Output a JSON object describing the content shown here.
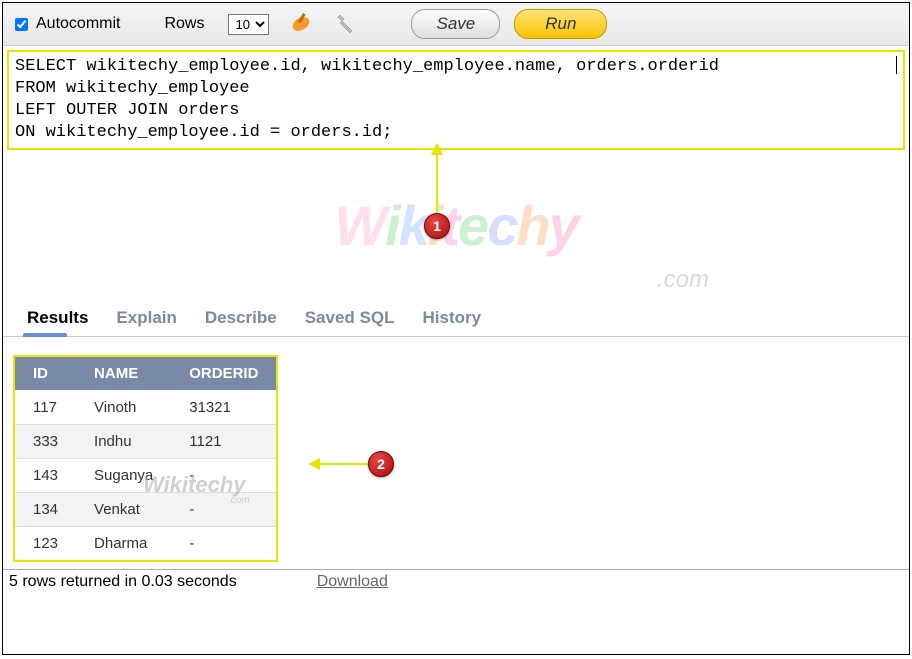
{
  "toolbar": {
    "autocommit_label": "Autocommit",
    "autocommit_checked": true,
    "rows_label": "Rows",
    "rows_value": "10",
    "save_label": "Save",
    "run_label": "Run"
  },
  "sql": {
    "text": "SELECT wikitechy_employee.id, wikitechy_employee.name, orders.orderid\nFROM wikitechy_employee\nLEFT OUTER JOIN orders\nON wikitechy_employee.id = orders.id;"
  },
  "tabs": {
    "results": "Results",
    "explain": "Explain",
    "describe": "Describe",
    "saved_sql": "Saved SQL",
    "history": "History",
    "active": "results"
  },
  "result_table": {
    "columns": [
      "ID",
      "NAME",
      "ORDERID"
    ],
    "rows": [
      {
        "id": "117",
        "name": "Vinoth",
        "orderid": "31321"
      },
      {
        "id": "333",
        "name": "Indhu",
        "orderid": "1121"
      },
      {
        "id": "143",
        "name": "Suganya",
        "orderid": "-"
      },
      {
        "id": "134",
        "name": "Venkat",
        "orderid": "-"
      },
      {
        "id": "123",
        "name": "Dharma",
        "orderid": "-"
      }
    ]
  },
  "status": {
    "rows_returned": "5 rows returned in 0.03 seconds",
    "download_label": "Download"
  },
  "annotations": {
    "badge1": "1",
    "badge2": "2"
  },
  "watermark": {
    "main": "Wikitechy",
    "sub": ".com"
  }
}
